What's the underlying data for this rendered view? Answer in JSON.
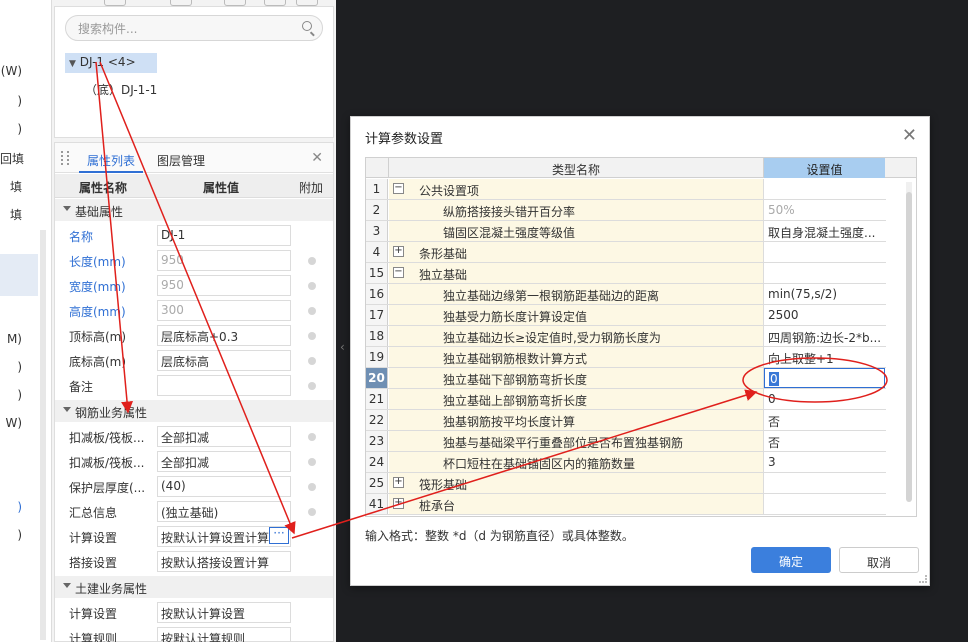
{
  "left_strip": {
    "items": [
      {
        "text": "(W)",
        "blue": false
      },
      {
        "text": ")",
        "blue": false
      },
      {
        "text": ")",
        "blue": false
      },
      {
        "text": "回填",
        "blue": false
      },
      {
        "text": "填",
        "blue": false
      },
      {
        "text": "填",
        "blue": false
      },
      {
        "text": "M)",
        "blue": false
      },
      {
        "text": ")",
        "blue": false
      },
      {
        "text": ")",
        "blue": false
      },
      {
        "text": "W)",
        "blue": false
      },
      {
        "text": ")",
        "blue": true
      },
      {
        "text": ")",
        "blue": false
      }
    ]
  },
  "tree": {
    "search_placeholder": "搜索构件...",
    "node_root": "DJ-1 <4>",
    "node_child": "（底）DJ-1-1"
  },
  "properties": {
    "tab_props": "属性列表",
    "tab_layers": "图层管理",
    "col_name": "属性名称",
    "col_value": "属性值",
    "col_extra": "附加",
    "groups": {
      "basic": "基础属性",
      "rebar": "钢筋业务属性",
      "civil": "土建业务属性"
    },
    "rows_basic": [
      {
        "name": "名称",
        "value": "DJ-1",
        "blue": true,
        "grey": false,
        "dot": false
      },
      {
        "name": "长度(mm)",
        "value": "950",
        "blue": true,
        "grey": true,
        "dot": true
      },
      {
        "name": "宽度(mm)",
        "value": "950",
        "blue": true,
        "grey": true,
        "dot": true
      },
      {
        "name": "高度(mm)",
        "value": "300",
        "blue": true,
        "grey": true,
        "dot": true
      },
      {
        "name": "顶标高(m)",
        "value": "层底标高+0.3",
        "blue": false,
        "grey": false,
        "dot": true
      },
      {
        "name": "底标高(m)",
        "value": "层底标高",
        "blue": false,
        "grey": false,
        "dot": true
      },
      {
        "name": "备注",
        "value": "",
        "blue": false,
        "grey": false,
        "dot": true
      }
    ],
    "rows_rebar": [
      {
        "name": "扣减板/筏板...",
        "value": "全部扣减",
        "dot": true
      },
      {
        "name": "扣减板/筏板...",
        "value": "全部扣减",
        "dot": true
      },
      {
        "name": "保护层厚度(...",
        "value": "(40)",
        "dot": true
      },
      {
        "name": "汇总信息",
        "value": "(独立基础)",
        "dot": true
      },
      {
        "name": "计算设置",
        "value": "按默认计算设置计算",
        "dot": false,
        "ellipsis": "···"
      },
      {
        "name": "搭接设置",
        "value": "按默认搭接设置计算",
        "dot": false
      }
    ],
    "rows_civil": [
      {
        "name": "计算设置",
        "value": "按默认计算设置"
      },
      {
        "name": "计算规则",
        "value": "按默认计算规则"
      }
    ]
  },
  "dialog": {
    "title": "计算参数设置",
    "col_type": "类型名称",
    "col_value": "设置值",
    "rows": [
      {
        "num": "1",
        "name": "公共设置项",
        "value": "",
        "toggle": "−",
        "kind": "grp"
      },
      {
        "num": "2",
        "name": "纵筋搭接接头错开百分率",
        "value": "50%",
        "toggle": "",
        "kind": "leaf",
        "grey": true
      },
      {
        "num": "3",
        "name": "锚固区混凝土强度等级值",
        "value": "取自身混凝土强度...",
        "toggle": "",
        "kind": "leaf"
      },
      {
        "num": "4",
        "name": "条形基础",
        "value": "",
        "toggle": "+",
        "kind": "grp"
      },
      {
        "num": "15",
        "name": "独立基础",
        "value": "",
        "toggle": "−",
        "kind": "grp"
      },
      {
        "num": "16",
        "name": "独立基础边缘第一根钢筋距基础边的距离",
        "value": "min(75,s/2)",
        "toggle": "",
        "kind": "leaf"
      },
      {
        "num": "17",
        "name": "独基受力筋长度计算设定值",
        "value": "2500",
        "toggle": "",
        "kind": "leaf"
      },
      {
        "num": "18",
        "name": "独立基础边长≥设定值时,受力钢筋长度为",
        "value": "四周钢筋:边长-2*b...",
        "toggle": "",
        "kind": "leaf"
      },
      {
        "num": "19",
        "name": "独立基础钢筋根数计算方式",
        "value": "向上取整+1",
        "toggle": "",
        "kind": "leaf"
      },
      {
        "num": "20",
        "name": "独立基础下部钢筋弯折长度",
        "value": "0",
        "toggle": "",
        "kind": "leaf",
        "active": true
      },
      {
        "num": "21",
        "name": "独立基础上部钢筋弯折长度",
        "value": "0",
        "toggle": "",
        "kind": "leaf"
      },
      {
        "num": "22",
        "name": "独基钢筋按平均长度计算",
        "value": "否",
        "toggle": "",
        "kind": "leaf"
      },
      {
        "num": "23",
        "name": "独基与基础梁平行重叠部位是否布置独基钢筋",
        "value": "否",
        "toggle": "",
        "kind": "leaf"
      },
      {
        "num": "24",
        "name": "杯口短柱在基础锚固区内的箍筋数量",
        "value": "3",
        "toggle": "",
        "kind": "leaf"
      },
      {
        "num": "25",
        "name": "筏形基础",
        "value": "",
        "toggle": "+",
        "kind": "grp"
      },
      {
        "num": "41",
        "name": "桩承台",
        "value": "",
        "toggle": "+",
        "kind": "grp"
      }
    ],
    "hint": "输入格式：整数 *d（d 为钢筋直径）或具体整数。",
    "ok": "确定",
    "cancel": "取消"
  },
  "colors": {
    "accent": "#2f6fd4",
    "annotation": "#e0201c",
    "name_cell_bg": "#fdf8e4",
    "header_value_bg": "#a8cdf0"
  }
}
